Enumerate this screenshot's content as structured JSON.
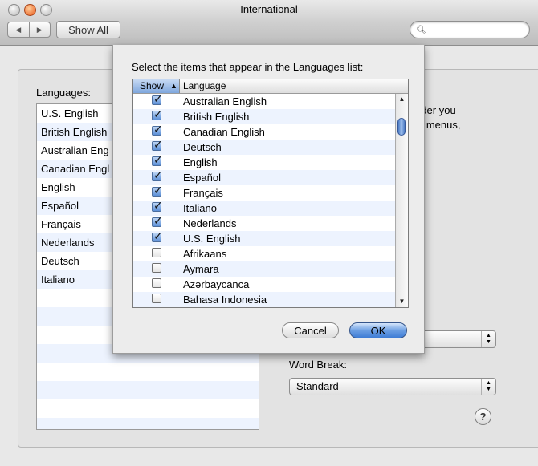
{
  "window": {
    "title": "International",
    "back_icon": "◀",
    "forward_icon": "▶",
    "show_all_label": "Show All",
    "search_placeholder": ""
  },
  "languages": {
    "label": "Languages:",
    "items": [
      "U.S. English",
      "British English",
      "Australian Eng",
      "Canadian Engl",
      "English",
      "Español",
      "Français",
      "Nederlands",
      "Deutsch",
      "Italiano"
    ]
  },
  "background_text": {
    "line1": "rder you",
    "line2": "n menus,"
  },
  "popups": {
    "sort_value": "",
    "word_break_label": "Word Break:",
    "word_break_value": "Standard"
  },
  "sheet": {
    "prompt": "Select the items that appear in the Languages list:",
    "columns": {
      "show": "Show",
      "language": "Language"
    },
    "rows": [
      {
        "label": "Australian English",
        "checked": true
      },
      {
        "label": "British English",
        "checked": true
      },
      {
        "label": "Canadian English",
        "checked": true
      },
      {
        "label": "Deutsch",
        "checked": true
      },
      {
        "label": "English",
        "checked": true
      },
      {
        "label": "Español",
        "checked": true
      },
      {
        "label": "Français",
        "checked": true
      },
      {
        "label": "Italiano",
        "checked": true
      },
      {
        "label": "Nederlands",
        "checked": true
      },
      {
        "label": "U.S. English",
        "checked": true
      },
      {
        "label": "Afrikaans",
        "checked": false
      },
      {
        "label": "Aymara",
        "checked": false
      },
      {
        "label": "Azərbaycanca",
        "checked": false
      },
      {
        "label": "Bahasa Indonesia",
        "checked": false
      }
    ],
    "cancel_label": "Cancel",
    "ok_label": "OK"
  },
  "icons": {
    "search": "search-icon",
    "sort_ascending": "▲",
    "help": "?"
  },
  "colors": {
    "accent": "#3e7cd5",
    "row_stripe": "#edf3fe"
  }
}
